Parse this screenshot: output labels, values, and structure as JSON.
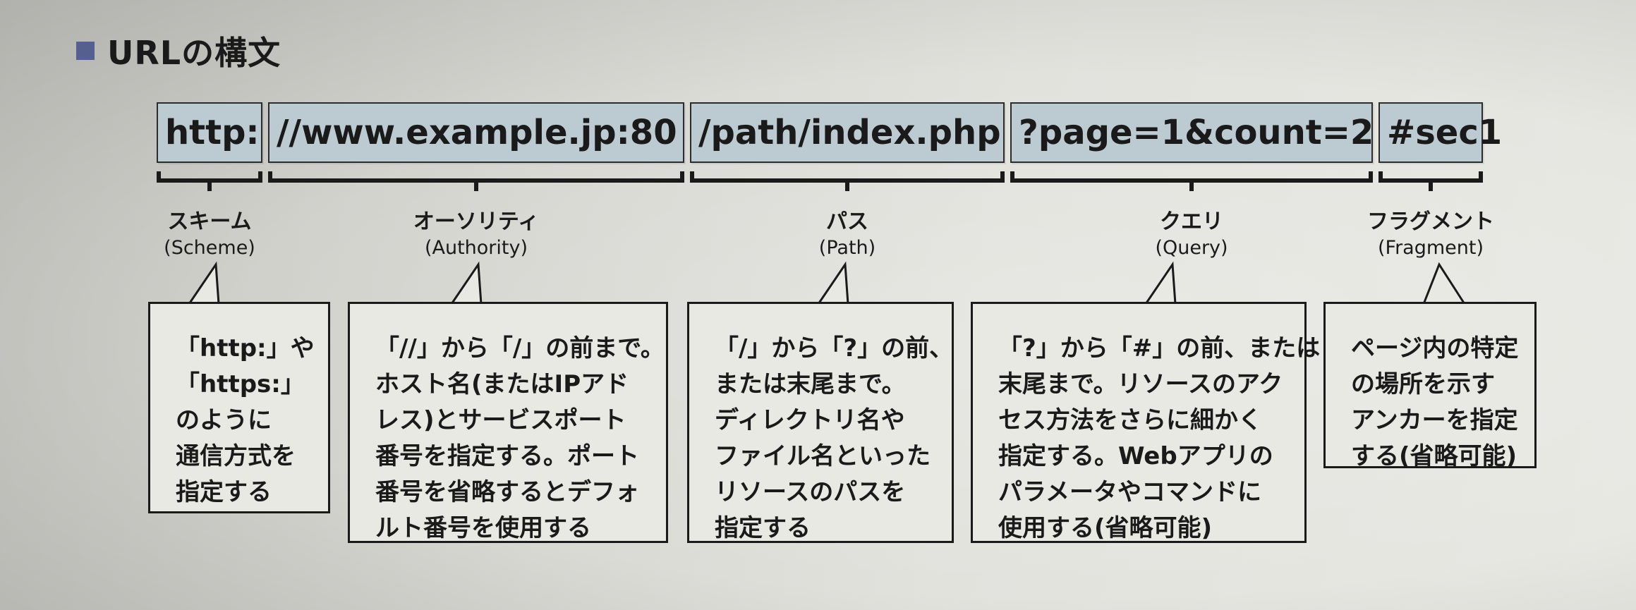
{
  "heading": "URLの構文",
  "segments": [
    {
      "text": "http:"
    },
    {
      "text": "//www.example.jp:80"
    },
    {
      "text": "/path/index.php"
    },
    {
      "text": "?page=1&count=2"
    },
    {
      "text": "#sec1"
    }
  ],
  "labels": [
    {
      "ja": "スキーム",
      "en": "(Scheme)"
    },
    {
      "ja": "オーソリティ",
      "en": "(Authority)"
    },
    {
      "ja": "パス",
      "en": "(Path)"
    },
    {
      "ja": "クエリ",
      "en": "(Query)"
    },
    {
      "ja": "フラグメント",
      "en": "(Fragment)"
    }
  ],
  "descriptions": [
    "「http:」や\n「https:」\nのように\n通信方式を\n指定する",
    "「//」から「/」の前まで。\nホスト名(またはIPアド\nレス)とサービスポート\n番号を指定する。ポート\n番号を省略するとデフォ\nルト番号を使用する",
    "「/」から「?」の前、\nまたは末尾まで。\nディレクトリ名や\nファイル名といった\nリソースのパスを\n指定する",
    "「?」から「#」の前、または\n末尾まで。リソースのアク\nセス方法をさらに細かく\n指定する。Webアプリの\nパラメータやコマンドに\n使用する(省略可能)",
    "ページ内の特定\nの場所を示す\nアンカーを指定\nする(省略可能)"
  ],
  "colors": {
    "segment_fill": "#bccad1",
    "heading_marker": "#566090",
    "page_background": "#d8d8d3"
  }
}
